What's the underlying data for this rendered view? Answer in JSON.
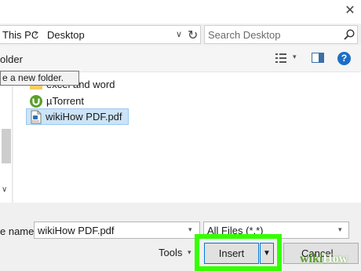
{
  "address": {
    "crumbs": [
      "This PC",
      "Desktop"
    ],
    "separator": "›",
    "chevron": "∨",
    "refresh": "↻"
  },
  "search": {
    "placeholder": "Search Desktop"
  },
  "toolbar": {
    "new_folder": "older",
    "view_caret": "▾"
  },
  "tooltip": {
    "text": "e a new folder."
  },
  "nav": {
    "scroll_down": "∨"
  },
  "files": [
    {
      "name": "excel and word",
      "icon": "folder-icon"
    },
    {
      "name": "µTorrent",
      "icon": "utorrent-icon"
    },
    {
      "name": "wikiHow PDF.pdf",
      "icon": "pdf-file-icon",
      "selected": true
    }
  ],
  "footer": {
    "filename_label": "e name:",
    "filename_value": "wikiHow PDF.pdf",
    "filter_value": "All Files (*.*)",
    "caret": "▾",
    "tools_label": "Tools",
    "insert_label": "Insert",
    "insert_dropdown": "▼",
    "cancel_label": "Cancel"
  },
  "watermark": {
    "a": "wiki",
    "b": "How"
  },
  "colors": {
    "highlight": "#35ff00",
    "accent": "#0078d7",
    "selection": "#cce4f7"
  }
}
